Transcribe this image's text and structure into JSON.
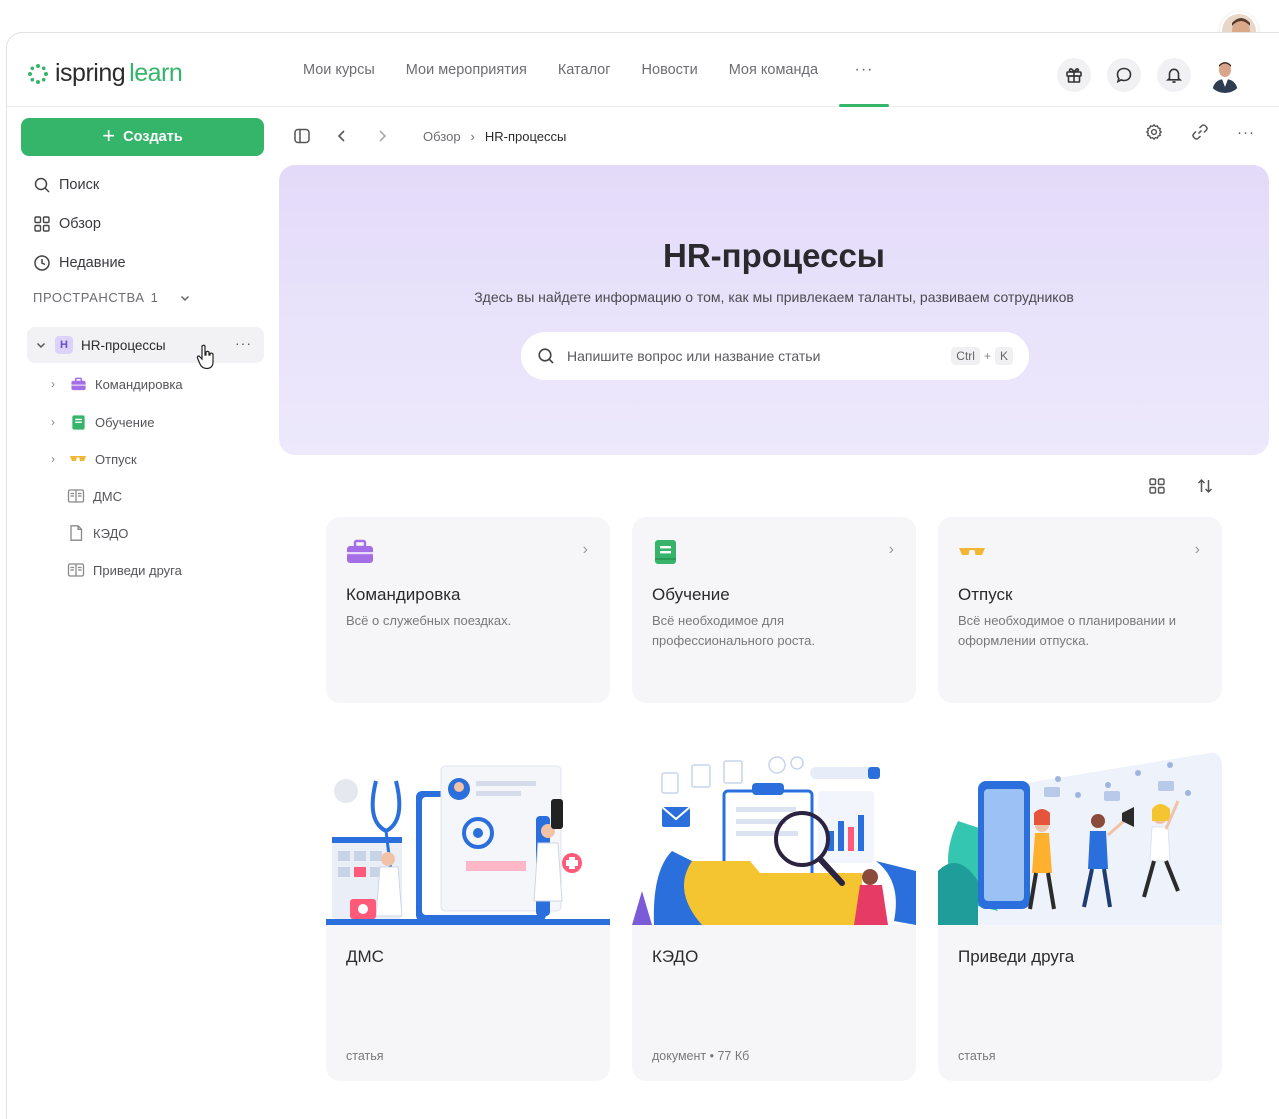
{
  "header": {
    "logo_part1": "ispring",
    "logo_part2": "learn",
    "nav": [
      "Мои курсы",
      "Мои мероприятия",
      "Каталог",
      "Новости",
      "Моя команда"
    ],
    "nav_more": "···"
  },
  "sidebar": {
    "create_label": "Создать",
    "links": [
      "Поиск",
      "Обзор",
      "Недавние"
    ],
    "spaces_label": "ПРОСТРАНСТВА",
    "spaces_count": "1",
    "root": {
      "badge": "H",
      "label": "HR-процессы",
      "dots": "···"
    },
    "children": [
      "Командировка",
      "Обучение",
      "Отпуск"
    ],
    "leaves": [
      "ДМС",
      "КЭДО",
      "Приведи друга"
    ]
  },
  "toolbar": {
    "crumb_parent": "Обзор",
    "crumb_current": "HR-процессы",
    "more": "···"
  },
  "hero": {
    "title": "HR-процессы",
    "description": "Здесь вы найдете информацию о том, как мы привлекаем таланты, развиваем сотрудников",
    "search_placeholder": "Напишите вопрос или название статьи",
    "kbd_ctrl": "Ctrl",
    "kbd_plus": "+",
    "kbd_k": "K"
  },
  "folders": [
    {
      "title": "Командировка",
      "desc": "Всё о служебных поездках."
    },
    {
      "title": "Обучение",
      "desc": "Всё необходимое для профессионального роста."
    },
    {
      "title": "Отпуск",
      "desc": "Всё необходимое о планировании и оформлении отпуска."
    }
  ],
  "articles": [
    {
      "title": "ДМС",
      "meta": "статья"
    },
    {
      "title": "КЭДО",
      "meta": "документ  •  77 Кб"
    },
    {
      "title": "Приведи друга",
      "meta": "статья"
    }
  ],
  "colors": {
    "accent": "#35b56a",
    "hero_bg": "#e6def9",
    "folder_purple": "#a46ee6",
    "folder_green": "#36b56a",
    "folder_yellow": "#f2b632"
  }
}
